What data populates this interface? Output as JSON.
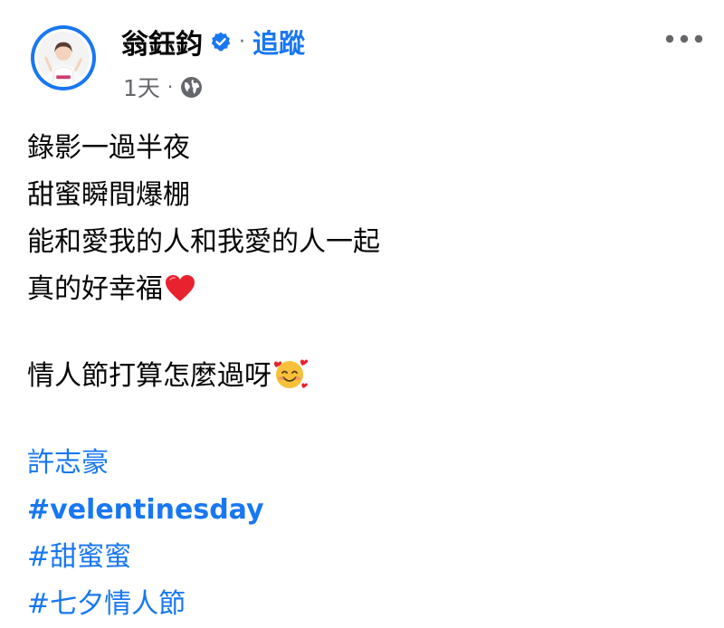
{
  "post": {
    "author": {
      "name": "翁鈺鈞",
      "follow_label": "追蹤",
      "separator": "·"
    },
    "meta": {
      "time": "1天",
      "separator": "·",
      "audience_icon": "globe-icon"
    },
    "more_icon": "more-options-icon",
    "body": {
      "lines": [
        "錄影一過半夜",
        "甜蜜瞬間爆棚",
        "能和愛我的人和我愛的人一起",
        "真的好幸福"
      ],
      "question": "情人節打算怎麼過呀"
    },
    "tags": {
      "mention": "許志豪",
      "hashtags": [
        "#velentinesday",
        "#甜蜜蜜",
        "#七夕情人節"
      ]
    }
  },
  "colors": {
    "link": "#1877f2",
    "text": "#050505",
    "muted": "#65676b"
  }
}
